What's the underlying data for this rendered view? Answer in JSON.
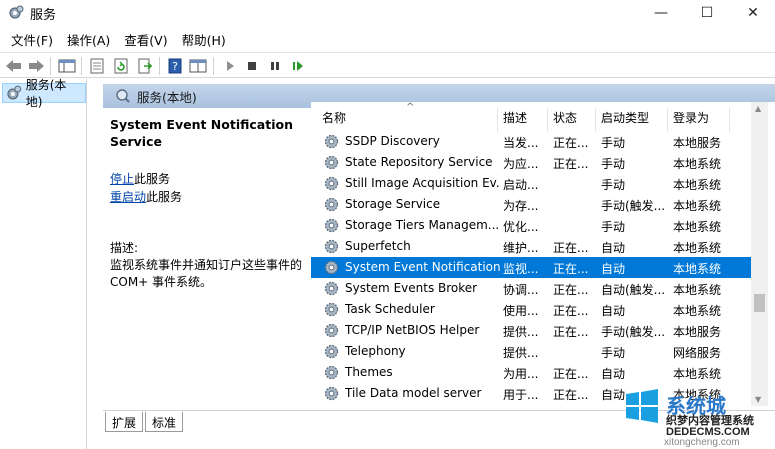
{
  "window": {
    "title": "服务",
    "minimize": "—",
    "maximize": "☐",
    "close": "✕"
  },
  "menu": [
    "文件(F)",
    "操作(A)",
    "查看(V)",
    "帮助(H)"
  ],
  "toolbar": {
    "icons": [
      "back-icon",
      "forward-icon",
      "console-tree-icon",
      "properties-icon",
      "refresh-icon",
      "export-icon",
      "help-icon",
      "view-icon",
      "start-icon",
      "stop-icon",
      "pause-icon",
      "restart-icon"
    ]
  },
  "tree": {
    "item_label": "服务(本地)"
  },
  "pane": {
    "header": "服务(本地)",
    "detail": {
      "title": "System Event Notification Service",
      "stop_link": "停止",
      "stop_suffix": "此服务",
      "restart_link": "重启动",
      "restart_suffix": "此服务",
      "desc_label": "描述:",
      "desc_text": "监视系统事件并通知订户这些事件的 COM+ 事件系统。"
    },
    "columns": [
      "名称",
      "描述",
      "状态",
      "启动类型",
      "登录为"
    ],
    "rows": [
      {
        "name": "SSDP Discovery",
        "desc": "当发...",
        "status": "正在...",
        "startup": "手动",
        "logon": "本地服务",
        "selected": false
      },
      {
        "name": "State Repository Service",
        "desc": "为应...",
        "status": "正在...",
        "startup": "手动",
        "logon": "本地系统",
        "selected": false
      },
      {
        "name": "Still Image Acquisition Ev...",
        "desc": "启动...",
        "status": "",
        "startup": "手动",
        "logon": "本地系统",
        "selected": false
      },
      {
        "name": "Storage Service",
        "desc": "为存...",
        "status": "",
        "startup": "手动(触发...",
        "logon": "本地系统",
        "selected": false
      },
      {
        "name": "Storage Tiers Managem...",
        "desc": "优化...",
        "status": "",
        "startup": "手动",
        "logon": "本地系统",
        "selected": false
      },
      {
        "name": "Superfetch",
        "desc": "维护...",
        "status": "正在...",
        "startup": "自动",
        "logon": "本地系统",
        "selected": false
      },
      {
        "name": "System Event Notification...",
        "desc": "监视...",
        "status": "正在...",
        "startup": "自动",
        "logon": "本地系统",
        "selected": true
      },
      {
        "name": "System Events Broker",
        "desc": "协调...",
        "status": "正在...",
        "startup": "自动(触发...",
        "logon": "本地系统",
        "selected": false
      },
      {
        "name": "Task Scheduler",
        "desc": "使用...",
        "status": "正在...",
        "startup": "自动",
        "logon": "本地系统",
        "selected": false
      },
      {
        "name": "TCP/IP NetBIOS Helper",
        "desc": "提供...",
        "status": "正在...",
        "startup": "手动(触发...",
        "logon": "本地服务",
        "selected": false
      },
      {
        "name": "Telephony",
        "desc": "提供...",
        "status": "",
        "startup": "手动",
        "logon": "网络服务",
        "selected": false
      },
      {
        "name": "Themes",
        "desc": "为用...",
        "status": "正在...",
        "startup": "自动",
        "logon": "本地系统",
        "selected": false
      },
      {
        "name": "Tile Data model server",
        "desc": "用于...",
        "status": "正在...",
        "startup": "自动",
        "logon": "本地系统",
        "selected": false
      }
    ],
    "tabs": [
      "扩展",
      "标准"
    ]
  },
  "watermark": {
    "brand": "系统城",
    "domain": "xitongcheng.com",
    "site": "DEDECMS.COM",
    "tagline": "织梦内容管理系统"
  },
  "colors": {
    "selection": "#0078d7",
    "header_gradient_top": "#c4d5ea",
    "link": "#0045a8"
  }
}
